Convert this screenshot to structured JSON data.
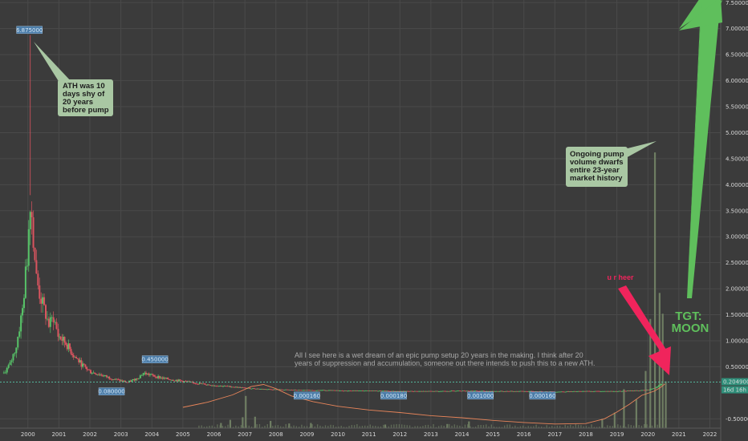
{
  "chart_data": {
    "type": "candlestick",
    "x_ticks": [
      "2000",
      "2001",
      "2002",
      "2003",
      "2004",
      "2005",
      "2006",
      "2007",
      "2008",
      "2009",
      "2010",
      "2011",
      "2012",
      "2013",
      "2014",
      "2015",
      "2016",
      "2017",
      "2018",
      "2019",
      "2020",
      "2021",
      "2022"
    ],
    "y_ticks": [
      7.5,
      7.0,
      6.5,
      6.0,
      5.5,
      5.0,
      4.5,
      4.0,
      3.5,
      3.0,
      2.5,
      2.0,
      1.5,
      1.0,
      0.5,
      -0.5
    ],
    "y_tick_labels": [
      "7.500000",
      "7.000000",
      "6.500000",
      "6.000000",
      "5.500000",
      "5.000000",
      "4.500000",
      "4.000000",
      "3.500000",
      "3.000000",
      "2.500000",
      "2.000000",
      "1.500000",
      "1.000000",
      "0.500000",
      "-0.500000"
    ],
    "ylim": [
      -0.68,
      7.55
    ],
    "xlim": [
      1999.1,
      2022.35
    ],
    "grid": true,
    "price_closes": [
      [
        1999.2,
        0.38
      ],
      [
        1999.4,
        0.55
      ],
      [
        1999.6,
        0.9
      ],
      [
        1999.8,
        1.6
      ],
      [
        1999.95,
        2.6
      ],
      [
        2000.05,
        3.8
      ],
      [
        2000.15,
        3.0
      ],
      [
        2000.25,
        2.2
      ],
      [
        2000.35,
        1.9
      ],
      [
        2000.5,
        1.6
      ],
      [
        2000.65,
        1.3
      ],
      [
        2000.8,
        1.45
      ],
      [
        2000.95,
        1.1
      ],
      [
        2001.2,
        0.95
      ],
      [
        2001.45,
        0.72
      ],
      [
        2001.7,
        0.55
      ],
      [
        2002.0,
        0.4
      ],
      [
        2002.3,
        0.35
      ],
      [
        2002.6,
        0.29
      ],
      [
        2002.9,
        0.24
      ],
      [
        2003.2,
        0.2
      ],
      [
        2003.5,
        0.28
      ],
      [
        2003.7,
        0.38
      ],
      [
        2004.0,
        0.33
      ],
      [
        2004.4,
        0.27
      ],
      [
        2004.8,
        0.24
      ],
      [
        2005.2,
        0.2
      ],
      [
        2005.6,
        0.17
      ],
      [
        2006.0,
        0.14
      ],
      [
        2006.5,
        0.12
      ],
      [
        2007.0,
        0.09
      ],
      [
        2007.6,
        0.07
      ],
      [
        2008.2,
        0.06
      ],
      [
        2008.8,
        0.05
      ],
      [
        2009.5,
        0.05
      ],
      [
        2010.2,
        0.04
      ],
      [
        2011.0,
        0.04
      ],
      [
        2012.0,
        0.03
      ],
      [
        2013.0,
        0.03
      ],
      [
        2014.0,
        0.04
      ],
      [
        2015.0,
        0.03
      ],
      [
        2016.0,
        0.03
      ],
      [
        2017.0,
        0.02
      ],
      [
        2018.0,
        0.03
      ],
      [
        2019.0,
        0.03
      ],
      [
        2019.9,
        0.05
      ],
      [
        2020.2,
        0.09
      ],
      [
        2020.45,
        0.204
      ]
    ],
    "volume_bars": [
      [
        2006.2,
        0.1
      ],
      [
        2006.5,
        0.16
      ],
      [
        2006.9,
        0.21
      ],
      [
        2007.0,
        0.62
      ],
      [
        2007.3,
        0.22
      ],
      [
        2007.8,
        0.14
      ],
      [
        2008.4,
        0.09
      ],
      [
        2009.1,
        0.1
      ],
      [
        2011.5,
        0.07
      ],
      [
        2013.5,
        0.08
      ],
      [
        2014.2,
        0.13
      ],
      [
        2018.5,
        0.18
      ],
      [
        2018.9,
        0.3
      ],
      [
        2019.2,
        0.75
      ],
      [
        2019.6,
        0.55
      ],
      [
        2019.9,
        1.1
      ],
      [
        2020.05,
        2.1
      ],
      [
        2020.2,
        5.3
      ],
      [
        2020.35,
        2.6
      ],
      [
        2020.45,
        2.2
      ],
      [
        2020.55,
        0.9
      ]
    ],
    "ma_line": [
      [
        2005.0,
        -0.28
      ],
      [
        2005.8,
        -0.18
      ],
      [
        2006.6,
        -0.04
      ],
      [
        2007.2,
        0.12
      ],
      [
        2007.6,
        0.16
      ],
      [
        2008.0,
        0.08
      ],
      [
        2008.5,
        -0.06
      ],
      [
        2009.2,
        -0.17
      ],
      [
        2010.0,
        -0.26
      ],
      [
        2011.0,
        -0.33
      ],
      [
        2012.0,
        -0.38
      ],
      [
        2013.0,
        -0.44
      ],
      [
        2014.0,
        -0.48
      ],
      [
        2015.0,
        -0.53
      ],
      [
        2016.0,
        -0.57
      ],
      [
        2017.0,
        -0.6
      ],
      [
        2018.0,
        -0.59
      ],
      [
        2018.6,
        -0.5
      ],
      [
        2019.0,
        -0.37
      ],
      [
        2019.4,
        -0.22
      ],
      [
        2019.8,
        -0.05
      ],
      [
        2020.2,
        0.03
      ],
      [
        2020.4,
        0.1
      ],
      [
        2020.55,
        0.17
      ]
    ],
    "current_price": 0.2049,
    "current_price_label": "0.204900",
    "countdown_label": "16d 16h",
    "annotations": [
      {
        "text_lines": [
          "ATH was 10",
          "days shy of",
          "20 years",
          "before pump"
        ]
      },
      {
        "text_lines": [
          "Ongoing pump",
          "volume dwarfs",
          "entire 23-year",
          "market history"
        ]
      },
      {
        "text": "u r heer"
      },
      {
        "text_lines": [
          "TGT:",
          "MOON"
        ]
      },
      {
        "text_lines": [
          "All I see here is a wet dream of an epic pump setup 20 years in the making. I think after 20",
          "years of suppression and accumulation, someone out there intends to push this to a new ATH."
        ]
      }
    ],
    "price_labels": [
      {
        "x": 2000.05,
        "value": 6.875,
        "text": "6.875000"
      },
      {
        "x": 2004.1,
        "value": 0.45,
        "text": "0.450000"
      },
      {
        "x": 2002.7,
        "value": 0.08,
        "text": "0.080000"
      },
      {
        "x": 2009.0,
        "value": 0.00016,
        "text": "0.000160"
      },
      {
        "x": 2011.8,
        "value": 0.00018,
        "text": "0.000180"
      },
      {
        "x": 2014.6,
        "value": 0.001,
        "text": "0.001000"
      },
      {
        "x": 2016.6,
        "value": 0.00016,
        "text": "0.000160"
      }
    ]
  },
  "colors": {
    "background": "#3b3b3b",
    "grid": "#4a4a4a",
    "up": "#57c268",
    "down": "#d9545f",
    "volume": "#6e7d62",
    "ma": "#e8855a",
    "arrow_green": "#5fbf5c",
    "arrow_pink": "#f0245c",
    "callout": "#a9c7a3",
    "price_line": "#57c7a9"
  }
}
